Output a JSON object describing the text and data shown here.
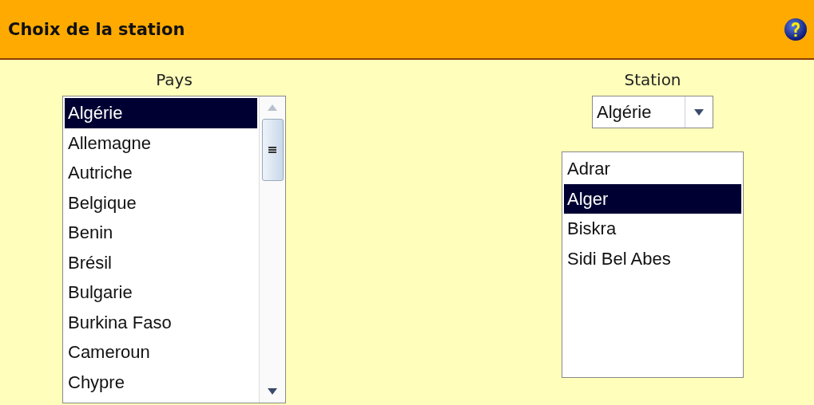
{
  "header": {
    "title": "Choix de la station"
  },
  "country_panel": {
    "label": "Pays",
    "items": [
      {
        "label": "Algérie",
        "selected": true
      },
      {
        "label": "Allemagne",
        "selected": false
      },
      {
        "label": "Autriche",
        "selected": false
      },
      {
        "label": "Belgique",
        "selected": false
      },
      {
        "label": "Benin",
        "selected": false
      },
      {
        "label": "Brésil",
        "selected": false
      },
      {
        "label": "Bulgarie",
        "selected": false
      },
      {
        "label": "Burkina Faso",
        "selected": false
      },
      {
        "label": "Cameroun",
        "selected": false
      },
      {
        "label": "Chypre",
        "selected": false
      }
    ]
  },
  "station_panel": {
    "label": "Station",
    "dropdown": {
      "value": "Algérie"
    },
    "items": [
      {
        "label": "Adrar",
        "selected": false
      },
      {
        "label": "Alger",
        "selected": true
      },
      {
        "label": "Biskra",
        "selected": false
      },
      {
        "label": "Sidi Bel Abes",
        "selected": false
      }
    ]
  }
}
